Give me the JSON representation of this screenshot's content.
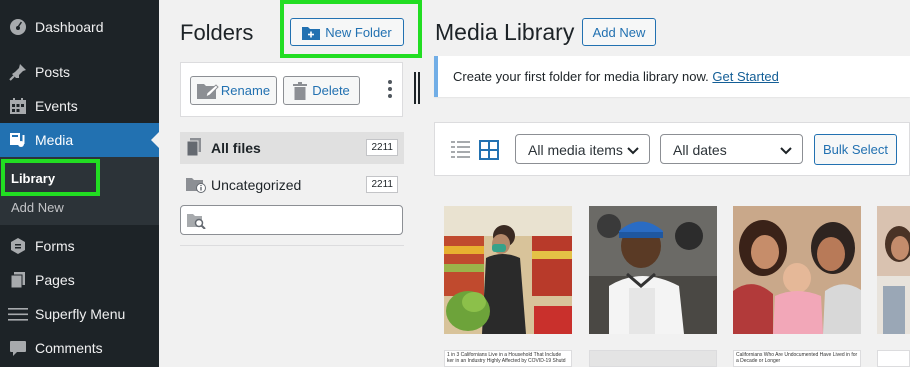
{
  "sidebar": {
    "items": [
      {
        "label": "Dashboard",
        "icon": "dashboard-icon"
      },
      {
        "label": "Posts",
        "icon": "pin-icon"
      },
      {
        "label": "Events",
        "icon": "calendar-icon"
      },
      {
        "label": "Media",
        "icon": "media-icon"
      },
      {
        "label": "Forms",
        "icon": "forms-icon"
      },
      {
        "label": "Pages",
        "icon": "pages-icon"
      },
      {
        "label": "Superfly Menu",
        "icon": "menu-lines-icon"
      },
      {
        "label": "Comments",
        "icon": "comment-icon"
      }
    ],
    "submenu": {
      "library": "Library",
      "add_new": "Add New"
    }
  },
  "folders": {
    "title": "Folders",
    "new_folder": "New Folder",
    "rename": "Rename",
    "delete": "Delete",
    "rows": [
      {
        "label": "All files",
        "count": "2211"
      },
      {
        "label": "Uncategorized",
        "count": "2211"
      }
    ],
    "search_placeholder": ""
  },
  "media": {
    "title": "Media Library",
    "add_new": "Add New",
    "notice_text": "Create your first folder for media library now.",
    "notice_link": "Get Started",
    "filter_type": "All media items",
    "filter_date": "All dates",
    "bulk_select": "Bulk Select",
    "doc_snippet_1": "1 in 3 Californians Live in a Household That Include ker in an Industry Highly Affected by COVID-19 Shutd",
    "doc_snippet_2": "Californians Who Are Undocumented Have Lived in for a Decade or Longer"
  },
  "colors": {
    "accent": "#2271b1",
    "sidebar": "#1d2327",
    "highlight": "#22dd22"
  }
}
